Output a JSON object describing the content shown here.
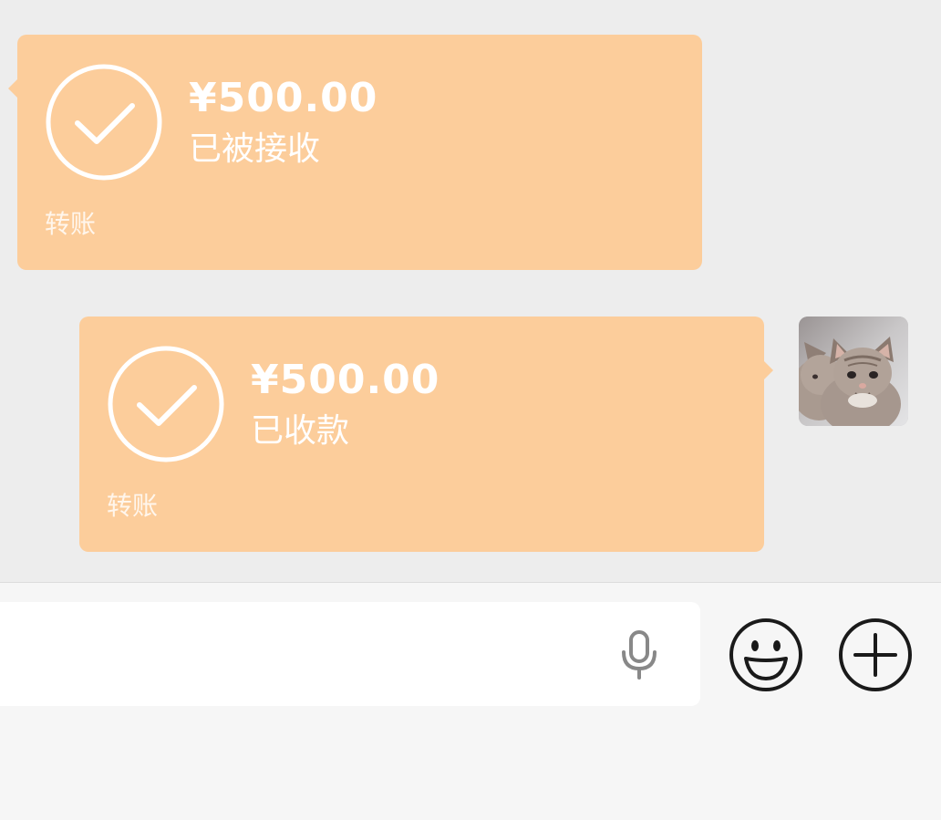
{
  "colors": {
    "background": "#ededed",
    "bubble": "#fccd9b",
    "bubble_text": "#ffffff",
    "input_bar": "#f6f6f6",
    "icon_dark": "#1a1a1a",
    "icon_gray": "#888888"
  },
  "messages": [
    {
      "direction": "received",
      "icon": "check-circle-icon",
      "amount": "¥500.00",
      "status": "已被接收",
      "type_label": "转账"
    },
    {
      "direction": "sent",
      "icon": "check-circle-icon",
      "amount": "¥500.00",
      "status": "已收款",
      "type_label": "转账",
      "avatar": "kitten-avatar-icon"
    }
  ],
  "input_bar": {
    "text_value": "",
    "voice_icon": "microphone-icon",
    "emoji_icon": "smiley-icon",
    "more_icon": "plus-circle-icon"
  }
}
